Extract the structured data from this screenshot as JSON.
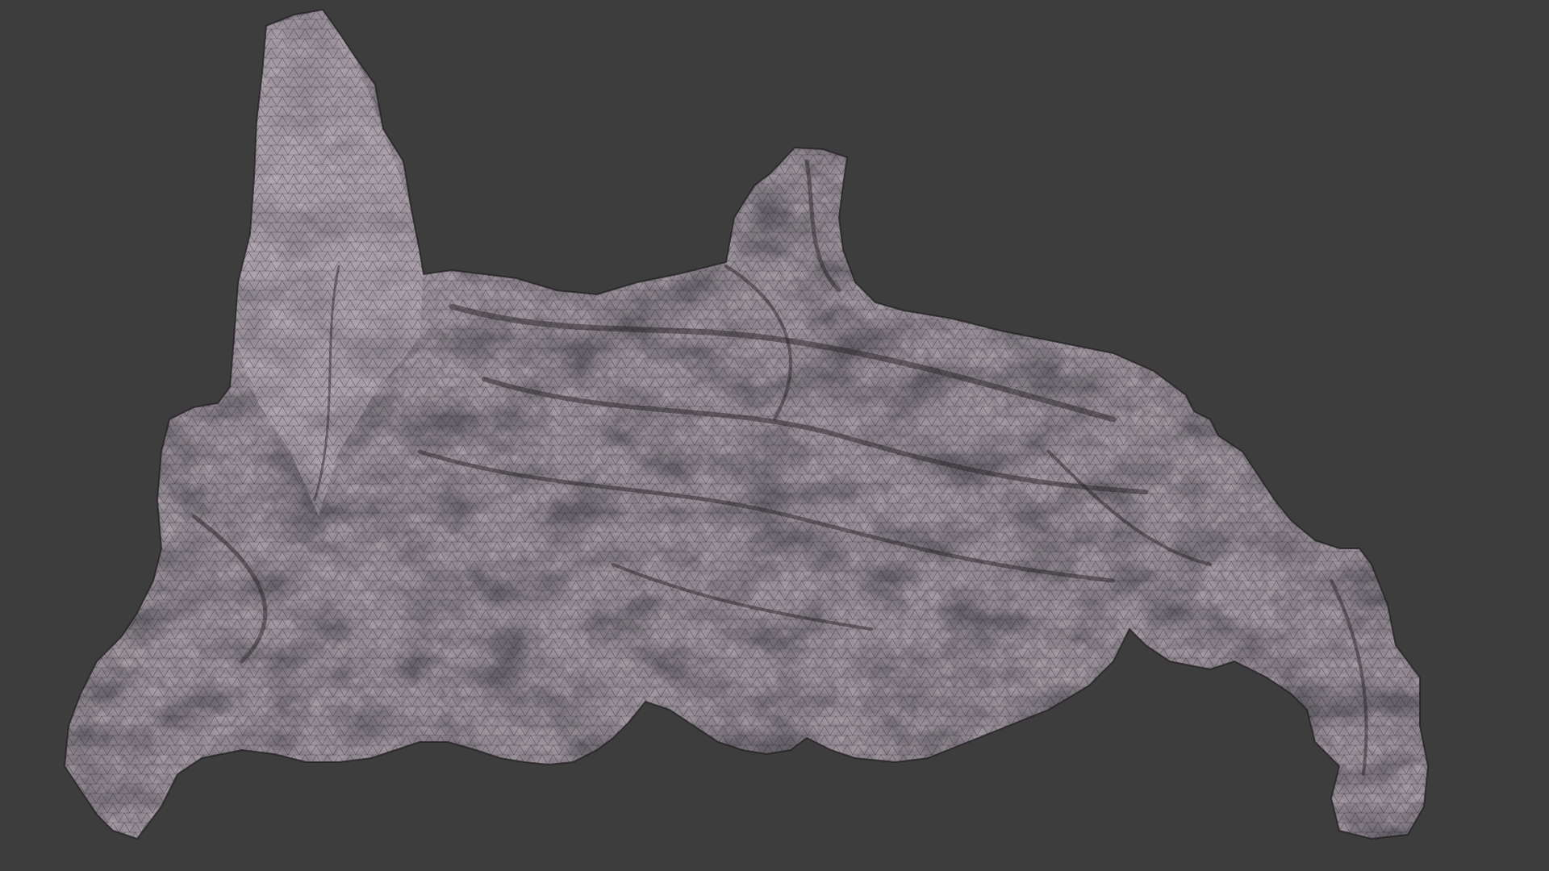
{
  "viewport": {
    "background_color": "#3d3d3d",
    "shading_mode": "wireframe-overlay",
    "object": {
      "type": "scanned-terrain-mesh",
      "surface_color": "#a49aa3",
      "highlight_color": "#c9bfc8",
      "shadow_color": "#242125",
      "wire_color": "#1c1a1d"
    }
  }
}
